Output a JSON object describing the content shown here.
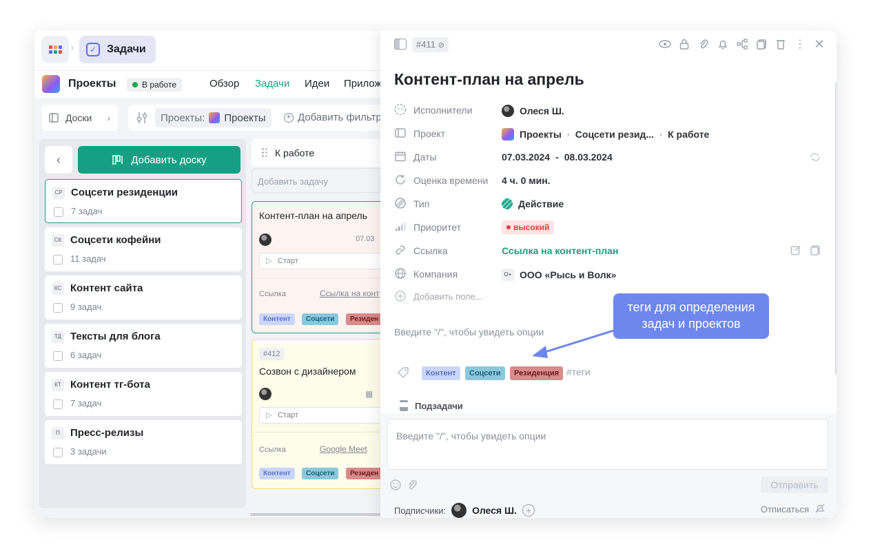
{
  "topbar": {
    "app_title": "Задачи"
  },
  "project_bar": {
    "name": "Проекты",
    "status": "В работе",
    "tabs": [
      "Обзор",
      "Задачи",
      "Идеи",
      "Прилож"
    ],
    "active_tab": "Задачи"
  },
  "filters": {
    "boards_label": "Доски",
    "project_filter_prefix": "Проекты:",
    "project_filter_value": "Проекты",
    "add_filter": "Добавить фильтр"
  },
  "boards": {
    "add_button": "Добавить доску",
    "items": [
      {
        "abbr": "СР",
        "title": "Соцсети резиденции",
        "count": "7 задач"
      },
      {
        "abbr": "СК",
        "title": "Соцсети кофейни",
        "count": "11 задач"
      },
      {
        "abbr": "КС",
        "title": "Контент сайта",
        "count": "9 задач"
      },
      {
        "abbr": "ТД",
        "title": "Тексты для блога",
        "count": "6 задач"
      },
      {
        "abbr": "КТ",
        "title": "Контент тг-бота",
        "count": "7 задач"
      },
      {
        "abbr": "П",
        "title": "Пресс-релизы",
        "count": "3 задачи"
      }
    ]
  },
  "column": {
    "title": "К работе",
    "add_task_placeholder": "Добавить задачу",
    "cards": [
      {
        "title": "Контент-план на апрель",
        "date": "07.03",
        "start": "Старт",
        "link_label": "Ссылка",
        "link_value": "Ссылка на конт",
        "tags": [
          "Контент",
          "Соцсети",
          "Резиден"
        ]
      },
      {
        "id": "#412",
        "title": "Созвон с дизайнером",
        "start": "Старт",
        "link_label": "Ссылка",
        "link_value": "Google Meet",
        "tags": [
          "Контент",
          "Соцсети",
          "Резиден"
        ]
      }
    ]
  },
  "task": {
    "id": "#411",
    "title": "Контент-план на апрель",
    "fields": {
      "assignees": {
        "label": "Исполнители",
        "value": "Олеся Ш."
      },
      "project": {
        "label": "Проект",
        "path": [
          "Проекты",
          "Соцсети резид...",
          "К работе"
        ]
      },
      "dates": {
        "label": "Даты",
        "from": "07.03.2024",
        "dash": "-",
        "to": "08.03.2024"
      },
      "estimate": {
        "label": "Оценка времени",
        "value": "4 ч. 0 мин."
      },
      "type": {
        "label": "Тип",
        "value": "Действие"
      },
      "priority": {
        "label": "Приоритет",
        "value": "высокий"
      },
      "link": {
        "label": "Ссылка",
        "value": "Ссылка на контент-план"
      },
      "company": {
        "label": "Компания",
        "logo": "O+",
        "value": "ООО «Рысь и Волк»"
      }
    },
    "add_field": "Добавить поле...",
    "description_placeholder": "Введите \"/\", чтобы увидеть опции",
    "tags": [
      "Контент",
      "Соцсети",
      "Резиденция"
    ],
    "tag_input_placeholder": "#теги",
    "subtasks_label": "Подзадачи",
    "comment_placeholder": "Введите \"/\", чтобы увидеть опции",
    "send_label": "Отправить",
    "followers_label": "Подписчики:",
    "follower_name": "Олеся Ш.",
    "unsubscribe": "Отписаться"
  },
  "callout": {
    "text_line1": "теги для определения",
    "text_line2": "задач и проектов"
  },
  "colors": {
    "accent": "#169f83",
    "tag_content": "#c9d6fb",
    "tag_social": "#8cc7dc",
    "tag_residence": "#d98a8a",
    "priority_high": "#e0413f",
    "callout": "#6e87ee"
  },
  "icons": [
    "grid-icon",
    "check-icon",
    "filter-icon",
    "eye-icon",
    "lock-icon",
    "paperclip-icon",
    "bell-icon",
    "flow-icon",
    "copy-icon",
    "trash-icon",
    "more-icon",
    "close-icon",
    "tag-icon",
    "emoji-icon",
    "bell-off-icon"
  ]
}
